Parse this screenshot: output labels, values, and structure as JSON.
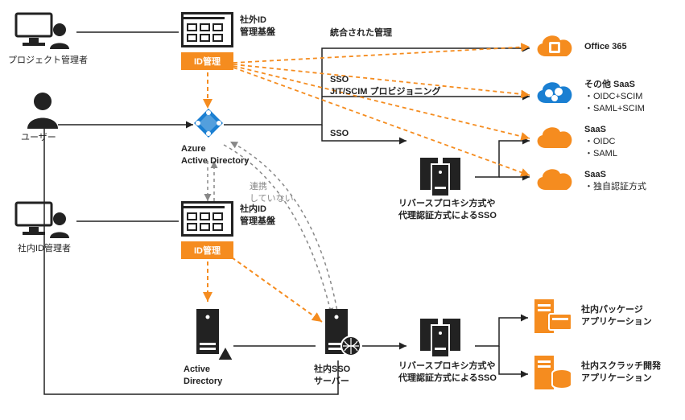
{
  "actors": {
    "project_manager": "プロジェクト管理者",
    "user": "ユーザー",
    "internal_admin": "社内ID管理者"
  },
  "panels": {
    "external": {
      "title_l1": "社外ID",
      "title_l2": "管理基盤",
      "button": "ID管理"
    },
    "internal": {
      "title_l1": "社内ID",
      "title_l2": "管理基盤",
      "button": "ID管理"
    }
  },
  "aad": {
    "name_l1": "Azure",
    "name_l2": "Active Directory"
  },
  "ad": {
    "name_l1": "Active",
    "name_l2": "Directory"
  },
  "sso_server": {
    "name_l1": "社内SSO",
    "name_l2": "サーバー"
  },
  "proxy_top": {
    "name_l1": "リバースプロキシ方式や",
    "name_l2": "代理認証方式によるSSO"
  },
  "proxy_bottom": {
    "name_l1": "リバースプロキシ方式や",
    "name_l2": "代理認証方式によるSSO"
  },
  "link_note": {
    "l1": "連携",
    "l2": "していない"
  },
  "edges": {
    "integrated_mgmt": "統合された管理",
    "sso": "SSO",
    "jit_scim": "JIT/SCIM プロビジョニング"
  },
  "clouds": {
    "office365": {
      "title": "Office 365",
      "sub": []
    },
    "other_saas": {
      "title": "その他 SaaS",
      "sub": [
        "・OIDC+SCIM",
        "・SAML+SCIM"
      ]
    },
    "saas_oidc_saml": {
      "title": "SaaS",
      "sub": [
        "・OIDC",
        "・SAML"
      ]
    },
    "saas_custom": {
      "title": "SaaS",
      "sub": [
        "・独自認証方式"
      ]
    }
  },
  "onprem_apps": {
    "package": {
      "l1": "社内パッケージ",
      "l2": "アプリケーション"
    },
    "scratch": {
      "l1": "社内スクラッチ開発",
      "l2": "アプリケーション"
    }
  },
  "colors": {
    "orange": "#F58C1F",
    "blue": "#1A7FD2",
    "dark": "#222222",
    "gray": "#888888"
  }
}
